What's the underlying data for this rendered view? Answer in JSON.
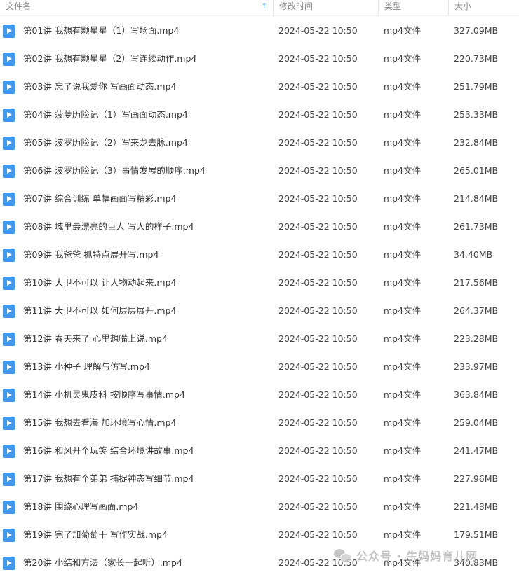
{
  "columns": {
    "name": "文件名",
    "date": "修改时间",
    "type": "类型",
    "size": "大小"
  },
  "sort_indicator": "↑",
  "files": [
    {
      "name": "第01讲 我想有颗星星（1）写场面.mp4",
      "date": "2024-05-22 10:50",
      "type": "mp4文件",
      "size": "327.09MB"
    },
    {
      "name": "第02讲 我想有颗星星（2）写连续动作.mp4",
      "date": "2024-05-22 10:50",
      "type": "mp4文件",
      "size": "220.73MB"
    },
    {
      "name": "第03讲 忘了说我爱你 写画面动态.mp4",
      "date": "2024-05-22 10:50",
      "type": "mp4文件",
      "size": "251.79MB"
    },
    {
      "name": "第04讲 菠萝历险记（1）写画面动态.mp4",
      "date": "2024-05-22 10:50",
      "type": "mp4文件",
      "size": "253.33MB"
    },
    {
      "name": "第05讲 波罗历险记（2）写来龙去脉.mp4",
      "date": "2024-05-22 10:50",
      "type": "mp4文件",
      "size": "232.84MB"
    },
    {
      "name": "第06讲 波罗历险记（3）事情发展的顺序.mp4",
      "date": "2024-05-22 10:50",
      "type": "mp4文件",
      "size": "265.01MB"
    },
    {
      "name": "第07讲 综合训练 单幅画面写精彩.mp4",
      "date": "2024-05-22 10:50",
      "type": "mp4文件",
      "size": "214.84MB"
    },
    {
      "name": "第08讲 城里最漂亮的巨人 写人的样子.mp4",
      "date": "2024-05-22 10:50",
      "type": "mp4文件",
      "size": "261.73MB"
    },
    {
      "name": "第09讲 我爸爸 抓特点展开写.mp4",
      "date": "2024-05-22 10:50",
      "type": "mp4文件",
      "size": "34.40MB"
    },
    {
      "name": "第10讲 大卫不可以 让人物动起来.mp4",
      "date": "2024-05-22 10:50",
      "type": "mp4文件",
      "size": "217.56MB"
    },
    {
      "name": "第11讲 大卫不可以 如何层层展开.mp4",
      "date": "2024-05-22 10:50",
      "type": "mp4文件",
      "size": "264.37MB"
    },
    {
      "name": "第12讲 春天来了 心里想嘴上说.mp4",
      "date": "2024-05-22 10:50",
      "type": "mp4文件",
      "size": "223.28MB"
    },
    {
      "name": "第13讲 小种子 理解与仿写.mp4",
      "date": "2024-05-22 10:50",
      "type": "mp4文件",
      "size": "233.97MB"
    },
    {
      "name": "第14讲 小机灵鬼皮科 按顺序写事情.mp4",
      "date": "2024-05-22 10:50",
      "type": "mp4文件",
      "size": "363.84MB"
    },
    {
      "name": "第15讲 我想去看海 加环境写心情.mp4",
      "date": "2024-05-22 10:50",
      "type": "mp4文件",
      "size": "259.04MB"
    },
    {
      "name": "第16讲 和风开个玩笑 结合环境讲故事.mp4",
      "date": "2024-05-22 10:50",
      "type": "mp4文件",
      "size": "241.47MB"
    },
    {
      "name": "第17讲 我想有个弟弟 捕捉神态写细节.mp4",
      "date": "2024-05-22 10:50",
      "type": "mp4文件",
      "size": "227.96MB"
    },
    {
      "name": "第18讲 围绕心理写画面.mp4",
      "date": "2024-05-22 10:50",
      "type": "mp4文件",
      "size": "221.48MB"
    },
    {
      "name": "第19讲 完了加葡萄干 写作实战.mp4",
      "date": "2024-05-22 10:50",
      "type": "mp4文件",
      "size": "179.51MB"
    },
    {
      "name": "第20讲 小结和方法（家长一起听）.mp4",
      "date": "2024-05-22 10:50",
      "type": "mp4文件",
      "size": "340.83MB"
    }
  ],
  "watermark": {
    "text": "公众号 · 牛妈妈育儿网"
  },
  "colors": {
    "accent": "#3f97ee",
    "header_text": "#888888"
  }
}
